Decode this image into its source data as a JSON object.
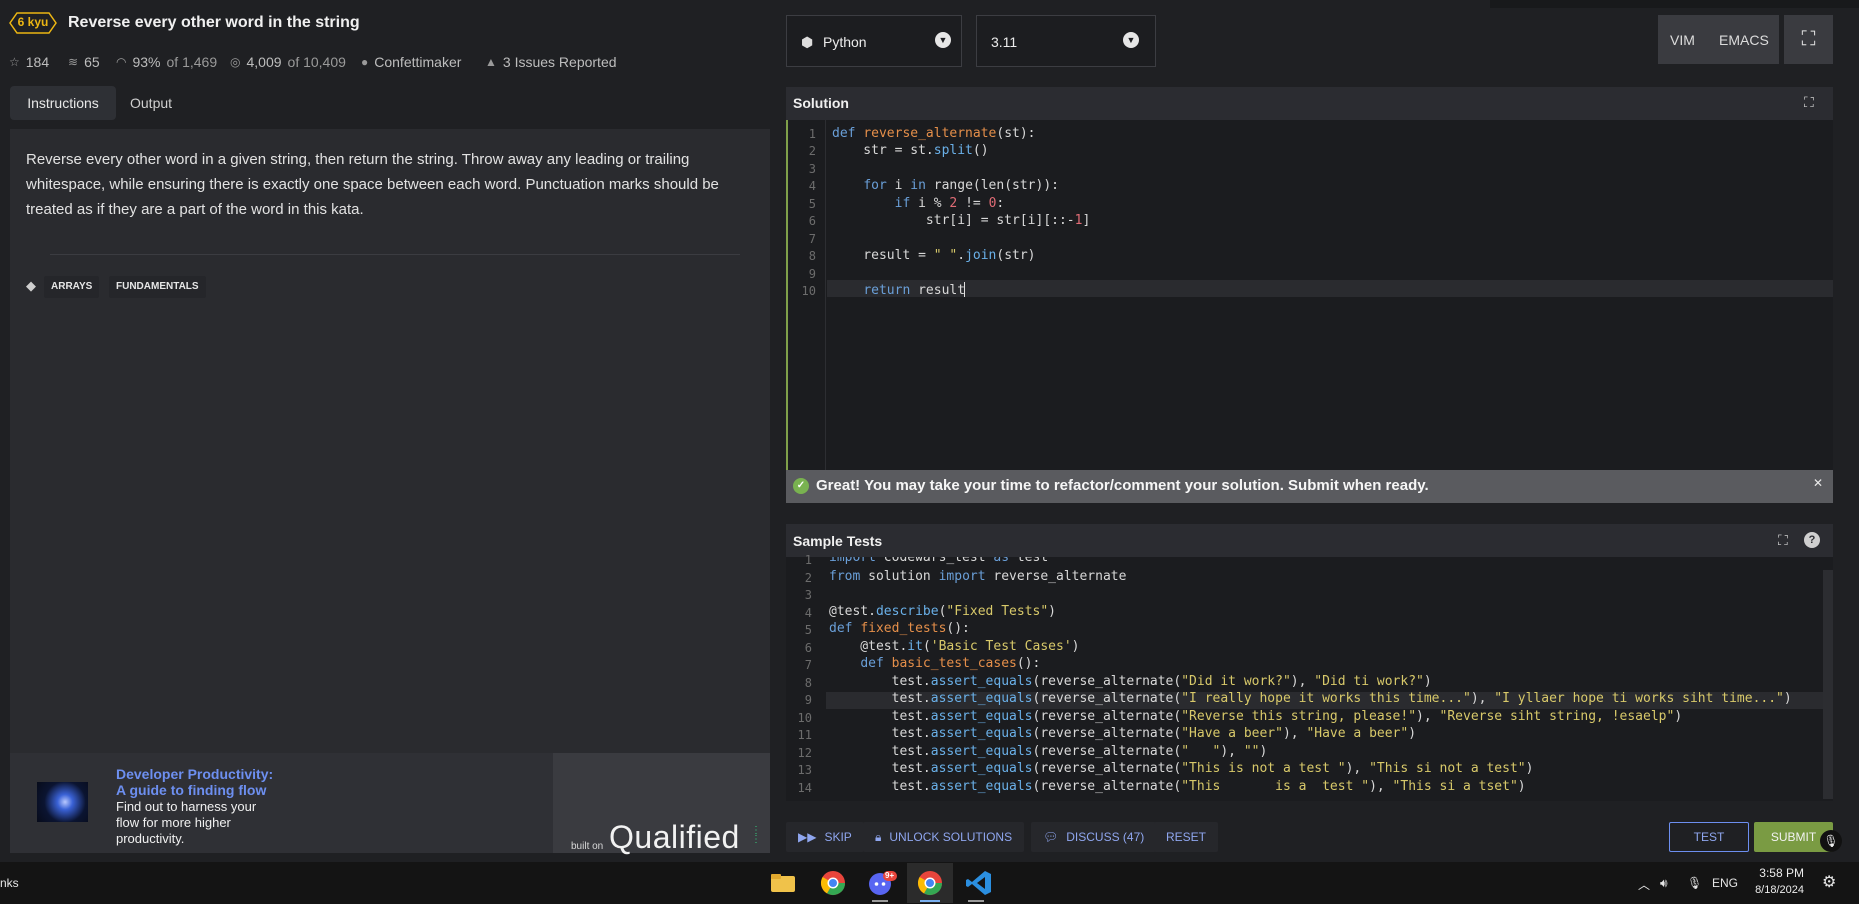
{
  "kata": {
    "rank": "6 kyu",
    "title": "Reverse every other word in the string",
    "stats": {
      "stars": "184",
      "collections": "65",
      "satisfaction": "93%",
      "satisfaction_of": "of 1,469",
      "completed": "4,009",
      "completed_of": "of 10,409",
      "author": "Confettimaker",
      "issues": "3 Issues Reported"
    }
  },
  "tabs": {
    "instructions": "Instructions",
    "output": "Output"
  },
  "instructions": {
    "text": "Reverse every other word in a given string, then return the string. Throw away any leading or trailing whitespace, while ensuring there is exactly one space between each word. Punctuation marks should be treated as if they are a part of the word in this kata.",
    "tags": [
      "ARRAYS",
      "FUNDAMENTALS"
    ]
  },
  "ad": {
    "title_line1": "Developer Productivity:",
    "title_line2": "A guide to finding flow",
    "text": "Find out to harness your flow for more higher productivity.",
    "built_on": "built on",
    "brand": "Qualified"
  },
  "toolbar": {
    "language": "Python",
    "version": "3.11",
    "vim": "VIM",
    "emacs": "EMACS"
  },
  "solution": {
    "title": "Solution",
    "line_numbers": [
      "1",
      "2",
      "3",
      "4",
      "5",
      "6",
      "7",
      "8",
      "9",
      "10"
    ]
  },
  "status": {
    "message": "Great! You may take your time to refactor/comment your solution. Submit when ready."
  },
  "sample_tests": {
    "title": "Sample Tests",
    "help": "?",
    "line_numbers": [
      "1",
      "2",
      "3",
      "4",
      "5",
      "6",
      "7",
      "8",
      "9",
      "10",
      "11",
      "12",
      "13",
      "14"
    ]
  },
  "actions": {
    "skip": "SKIP",
    "unlock": "UNLOCK SOLUTIONS",
    "discuss": "DISCUSS (47)",
    "reset": "RESET",
    "test": "TEST",
    "submit": "SUBMIT"
  },
  "taskbar": {
    "left_text": "nks",
    "lang": "ENG",
    "time": "3:58 PM",
    "date": "8/18/2024",
    "badge": "9+"
  },
  "colors": {
    "accent_blue": "#6d8ff0",
    "submit_green": "#7a9b43",
    "rank_yellow": "#ecb613",
    "success_green": "#79b250"
  }
}
